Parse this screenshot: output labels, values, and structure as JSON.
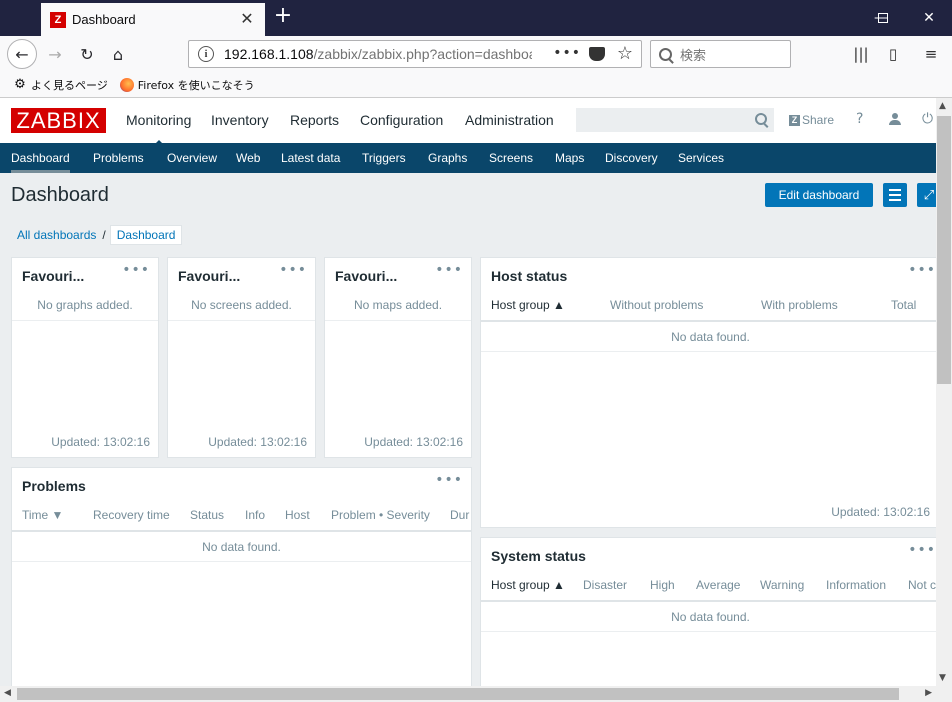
{
  "browser": {
    "tab_title": "Dashboard",
    "tab_favicon": "Z",
    "url_host": "192.168.1.108",
    "url_path": "/zabbix/zabbix.php?action=dashboard.view",
    "search_placeholder": "検索",
    "bookmarks": [
      "よく見るページ",
      "Firefox を使いこなそう"
    ]
  },
  "zabbix": {
    "logo": "ZABBIX",
    "main_menu": [
      "Monitoring",
      "Inventory",
      "Reports",
      "Configuration",
      "Administration"
    ],
    "share_label": "Share",
    "help_label": "?",
    "sub_menu": [
      "Dashboard",
      "Problems",
      "Overview",
      "Web",
      "Latest data",
      "Triggers",
      "Graphs",
      "Screens",
      "Maps",
      "Discovery",
      "Services"
    ],
    "page_title": "Dashboard",
    "edit_dashboard": "Edit dashboard",
    "breadcrumbs": {
      "all": "All dashboards",
      "sep": "/",
      "current": "Dashboard"
    }
  },
  "widgets": {
    "fav_graphs": {
      "title": "Favouri...",
      "message": "No graphs added.",
      "updated": "Updated: 13:02:16"
    },
    "fav_screens": {
      "title": "Favouri...",
      "message": "No screens added.",
      "updated": "Updated: 13:02:16"
    },
    "fav_maps": {
      "title": "Favouri...",
      "message": "No maps added.",
      "updated": "Updated: 13:02:16"
    },
    "host_status": {
      "title": "Host status",
      "columns": [
        "Host group ▲",
        "Without problems",
        "With problems",
        "Total"
      ],
      "no_data": "No data found.",
      "updated": "Updated: 13:02:16"
    },
    "problems": {
      "title": "Problems",
      "columns": [
        "Time ▼",
        "Recovery time",
        "Status",
        "Info",
        "Host",
        "Problem • Severity",
        "Dur"
      ],
      "no_data": "No data found."
    },
    "system_status": {
      "title": "System status",
      "columns": [
        "Host group ▲",
        "Disaster",
        "High",
        "Average",
        "Warning",
        "Information",
        "Not c"
      ],
      "no_data": "No data found."
    },
    "dots": "•••"
  },
  "colors": {
    "brand_red": "#d40000",
    "nav_blue": "#0a466a",
    "button_blue": "#0275b8"
  }
}
